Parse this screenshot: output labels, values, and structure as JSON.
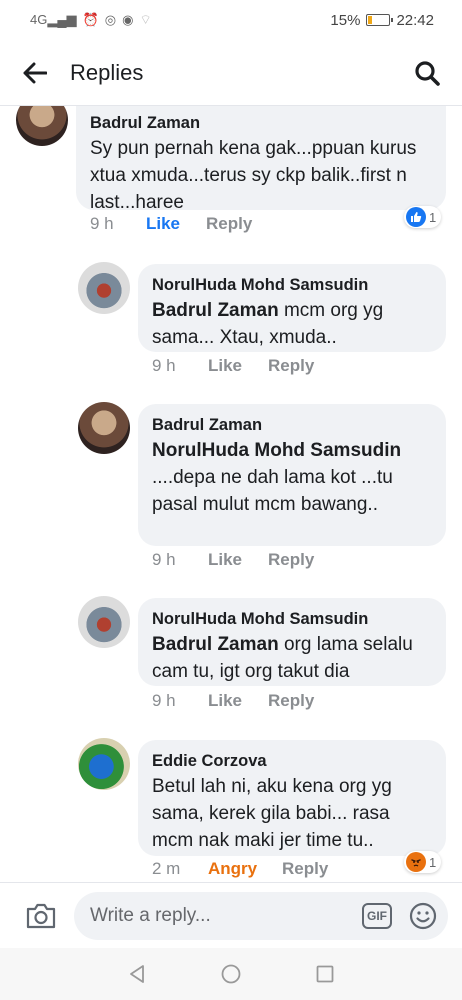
{
  "status_bar": {
    "network": "4G",
    "battery_percent": "15%",
    "battery_level": 0.15,
    "time": "22:42",
    "battery_color": "#f0a818"
  },
  "header": {
    "title": "Replies",
    "back_icon": "arrow-left-icon",
    "search_icon": "search-icon"
  },
  "comments": [
    {
      "author": "Badrul Zaman",
      "mention": "",
      "text": "Sy pun pernah kena gak...ppuan kurus xtua xmuda...terus sy ckp balik..first n last...haree",
      "time": "9 h",
      "like_label": "Like",
      "like_state": "liked",
      "reply_label": "Reply",
      "reaction_count": "1",
      "reaction": "like"
    },
    {
      "author": "NorulHuda Mohd Samsudin",
      "mention": "Badrul Zaman",
      "text": " mcm org yg sama... Xtau, xmuda..",
      "time": "9 h",
      "like_label": "Like",
      "reply_label": "Reply"
    },
    {
      "author": "Badrul Zaman",
      "mention": "NorulHuda Mohd Samsudin",
      "text": " ....depa ne dah lama kot ...tu pasal mulut mcm bawang..",
      "time": "9 h",
      "like_label": "Like",
      "reply_label": "Reply"
    },
    {
      "author": "NorulHuda Mohd Samsudin",
      "mention": "Badrul Zaman",
      "text": " org lama selalu cam tu, igt org takut dia",
      "time": "9 h",
      "like_label": "Like",
      "reply_label": "Reply"
    },
    {
      "author": "Eddie Corzova",
      "mention": "",
      "text": "Betul lah ni, aku kena org yg sama, kerek gila babi... rasa mcm nak maki jer time tu..",
      "time": "2 m",
      "like_label": "Angry",
      "like_state": "angry",
      "reply_label": "Reply",
      "reaction_count": "1",
      "reaction": "angry"
    }
  ],
  "composer": {
    "placeholder": "Write a reply...",
    "gif_label": "GIF",
    "camera_icon": "camera-icon",
    "emoji_icon": "emoji-icon"
  },
  "colors": {
    "like_blue": "#1877f2",
    "angry_orange": "#e9710f",
    "bubble_bg": "#f0f2f5"
  }
}
